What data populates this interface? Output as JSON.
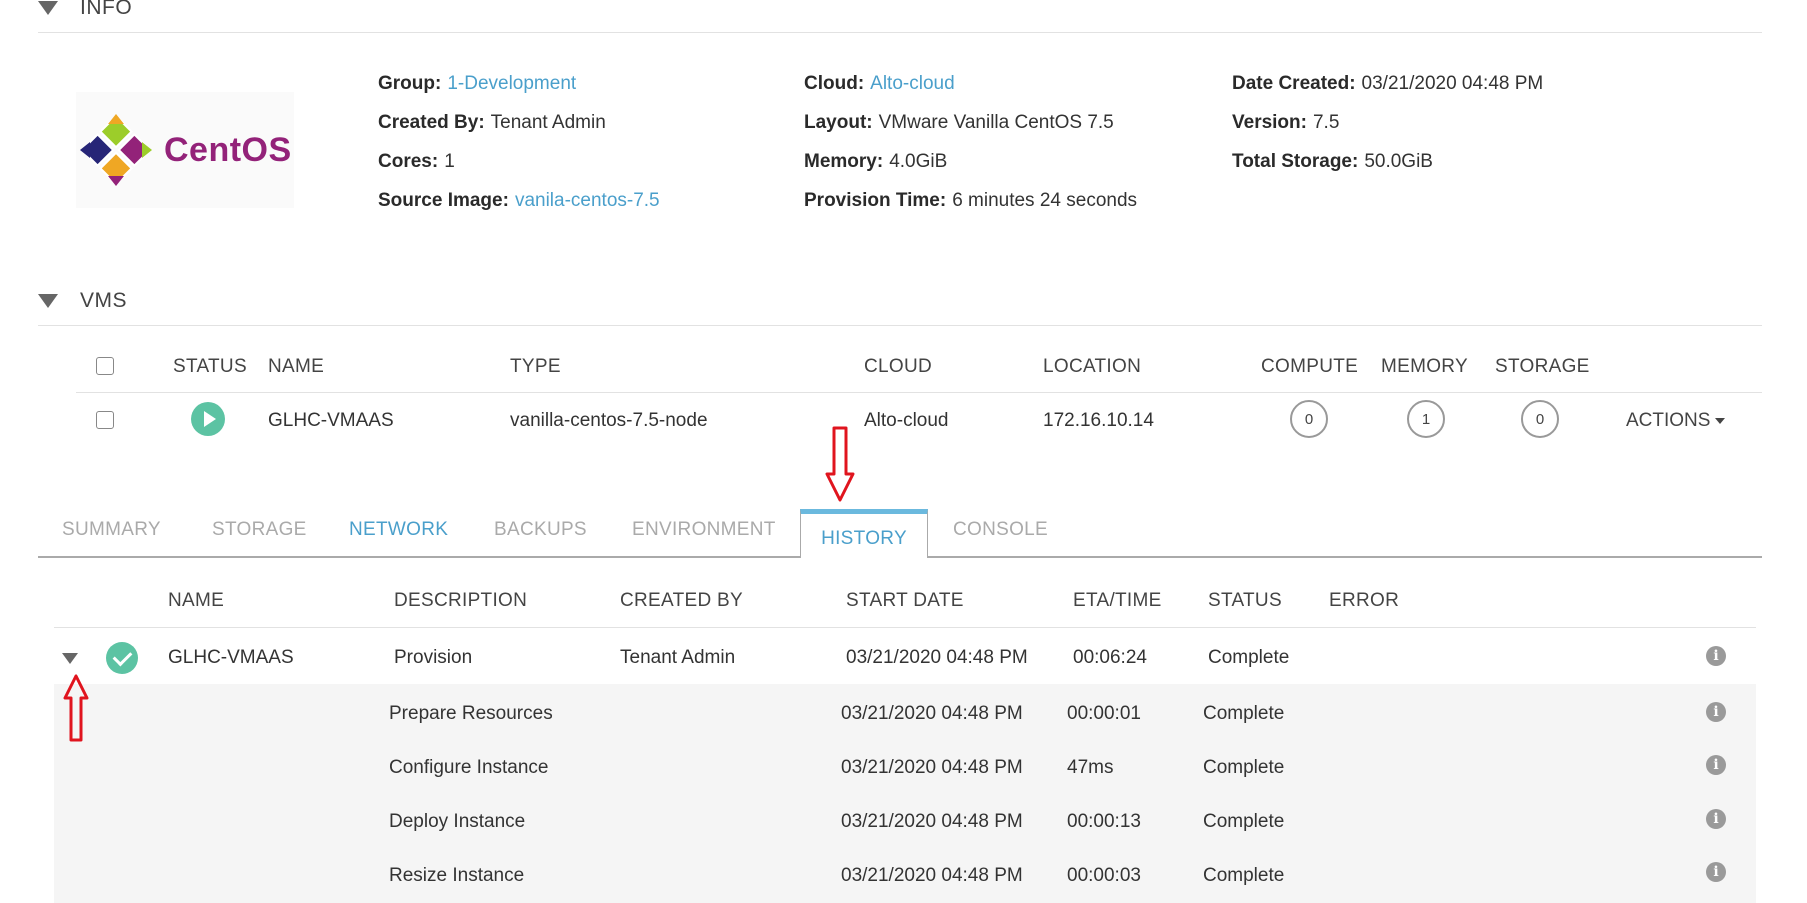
{
  "info": {
    "title": "INFO",
    "logo_text": "CentOS",
    "fields": {
      "group": {
        "label": "Group:",
        "value": "1-Development"
      },
      "created_by": {
        "label": "Created By:",
        "value": "Tenant Admin"
      },
      "cores": {
        "label": "Cores:",
        "value": "1"
      },
      "source_image": {
        "label": "Source Image:",
        "value": "vanila-centos-7.5"
      },
      "cloud": {
        "label": "Cloud:",
        "value": "Alto-cloud"
      },
      "layout": {
        "label": "Layout:",
        "value": "VMware Vanilla CentOS 7.5"
      },
      "memory": {
        "label": "Memory:",
        "value": "4.0GiB"
      },
      "provision_time": {
        "label": "Provision Time:",
        "value": "6 minutes 24 seconds"
      },
      "date_created": {
        "label": "Date Created:",
        "value": "03/21/2020 04:48 PM"
      },
      "version": {
        "label": "Version:",
        "value": "7.5"
      },
      "total_storage": {
        "label": "Total Storage:",
        "value": "50.0GiB"
      }
    }
  },
  "vms": {
    "title": "VMS",
    "columns": [
      "STATUS",
      "NAME",
      "TYPE",
      "CLOUD",
      "LOCATION",
      "COMPUTE",
      "MEMORY",
      "STORAGE"
    ],
    "row": {
      "name": "GLHC-VMAAS",
      "type": "vanilla-centos-7.5-node",
      "cloud": "Alto-cloud",
      "location": "172.16.10.14",
      "compute": "0",
      "memory": "1",
      "storage": "0",
      "actions": "ACTIONS"
    }
  },
  "tabs": [
    "SUMMARY",
    "STORAGE",
    "NETWORK",
    "BACKUPS",
    "ENVIRONMENT",
    "HISTORY",
    "CONSOLE"
  ],
  "history": {
    "columns": [
      "NAME",
      "DESCRIPTION",
      "CREATED BY",
      "START DATE",
      "ETA/TIME",
      "STATUS",
      "ERROR"
    ],
    "main": {
      "name": "GLHC-VMAAS",
      "description": "Provision",
      "created_by": "Tenant Admin",
      "start_date": "03/21/2020 04:48 PM",
      "eta": "00:06:24",
      "status": "Complete"
    },
    "steps": [
      {
        "description": "Prepare Resources",
        "start_date": "03/21/2020 04:48 PM",
        "eta": "00:00:01",
        "status": "Complete"
      },
      {
        "description": "Configure Instance",
        "start_date": "03/21/2020 04:48 PM",
        "eta": "47ms",
        "status": "Complete"
      },
      {
        "description": "Deploy Instance",
        "start_date": "03/21/2020 04:48 PM",
        "eta": "00:00:13",
        "status": "Complete"
      },
      {
        "description": "Resize Instance",
        "start_date": "03/21/2020 04:48 PM",
        "eta": "00:00:03",
        "status": "Complete"
      }
    ]
  },
  "icons": {
    "info": "i",
    "arrow_color": "#e0141e",
    "accent": "#4a9fcb",
    "status_green": "#5cc3a3"
  }
}
